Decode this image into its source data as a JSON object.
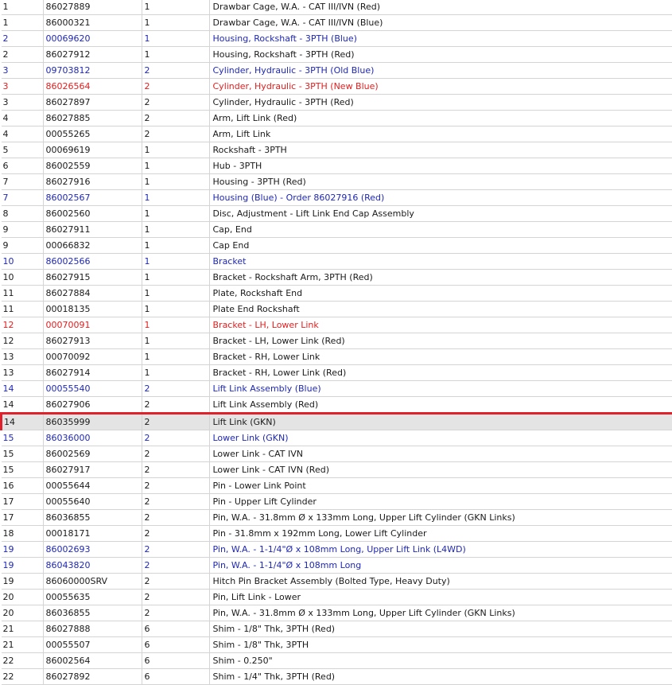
{
  "colors": {
    "default_text": "#1a1a1a",
    "blue_text": "#1f28b3",
    "red_text": "#e02020",
    "selection_outline": "#e0202a",
    "selection_fill": "#e4e4e4",
    "grid_line": "#d4d4d4"
  },
  "rows": [
    {
      "ref": "1",
      "part": "86027889",
      "qty": "1",
      "desc": "Drawbar Cage, W.A. - CAT III/IVN (Red)",
      "style": "dark"
    },
    {
      "ref": "1",
      "part": "86000321",
      "qty": "1",
      "desc": "Drawbar Cage, W.A. - CAT III/IVN (Blue)",
      "style": "dark"
    },
    {
      "ref": "2",
      "part": "00069620",
      "qty": "1",
      "desc": "Housing, Rockshaft - 3PTH (Blue)",
      "style": "blue"
    },
    {
      "ref": "2",
      "part": "86027912",
      "qty": "1",
      "desc": "Housing, Rockshaft - 3PTH (Red)",
      "style": "dark"
    },
    {
      "ref": "3",
      "part": "09703812",
      "qty": "2",
      "desc": "Cylinder, Hydraulic - 3PTH (Old Blue)",
      "style": "blue"
    },
    {
      "ref": "3",
      "part": "86026564",
      "qty": "2",
      "desc": "Cylinder, Hydraulic - 3PTH (New Blue)",
      "style": "red"
    },
    {
      "ref": "3",
      "part": "86027897",
      "qty": "2",
      "desc": "Cylinder, Hydraulic - 3PTH (Red)",
      "style": "dark"
    },
    {
      "ref": "4",
      "part": "86027885",
      "qty": "2",
      "desc": "Arm, Lift Link (Red)",
      "style": "dark"
    },
    {
      "ref": "4",
      "part": "00055265",
      "qty": "2",
      "desc": "Arm, Lift Link",
      "style": "dark"
    },
    {
      "ref": "5",
      "part": "00069619",
      "qty": "1",
      "desc": "Rockshaft - 3PTH",
      "style": "dark"
    },
    {
      "ref": "6",
      "part": "86002559",
      "qty": "1",
      "desc": "Hub - 3PTH",
      "style": "dark"
    },
    {
      "ref": "7",
      "part": "86027916",
      "qty": "1",
      "desc": "Housing - 3PTH (Red)",
      "style": "dark"
    },
    {
      "ref": "7",
      "part": "86002567",
      "qty": "1",
      "desc": "Housing (Blue) - Order 86027916 (Red)",
      "style": "blue"
    },
    {
      "ref": "8",
      "part": "86002560",
      "qty": "1",
      "desc": "Disc, Adjustment - Lift Link End Cap Assembly",
      "style": "dark"
    },
    {
      "ref": "9",
      "part": "86027911",
      "qty": "1",
      "desc": "Cap, End",
      "style": "dark"
    },
    {
      "ref": "9",
      "part": "00066832",
      "qty": "1",
      "desc": "Cap End",
      "style": "dark"
    },
    {
      "ref": "10",
      "part": "86002566",
      "qty": "1",
      "desc": "Bracket",
      "style": "blue"
    },
    {
      "ref": "10",
      "part": "86027915",
      "qty": "1",
      "desc": "Bracket - Rockshaft Arm, 3PTH (Red)",
      "style": "dark"
    },
    {
      "ref": "11",
      "part": "86027884",
      "qty": "1",
      "desc": "Plate, Rockshaft End",
      "style": "dark"
    },
    {
      "ref": "11",
      "part": "00018135",
      "qty": "1",
      "desc": "Plate End Rockshaft",
      "style": "dark"
    },
    {
      "ref": "12",
      "part": "00070091",
      "qty": "1",
      "desc": "Bracket - LH, Lower Link",
      "style": "red"
    },
    {
      "ref": "12",
      "part": "86027913",
      "qty": "1",
      "desc": "Bracket - LH, Lower Link (Red)",
      "style": "dark"
    },
    {
      "ref": "13",
      "part": "00070092",
      "qty": "1",
      "desc": "Bracket - RH, Lower Link",
      "style": "dark"
    },
    {
      "ref": "13",
      "part": "86027914",
      "qty": "1",
      "desc": "Bracket - RH, Lower Link (Red)",
      "style": "dark"
    },
    {
      "ref": "14",
      "part": "00055540",
      "qty": "2",
      "desc": "Lift Link Assembly (Blue)",
      "style": "blue"
    },
    {
      "ref": "14",
      "part": "86027906",
      "qty": "2",
      "desc": "Lift Link Assembly (Red)",
      "style": "dark"
    },
    {
      "ref": "14",
      "part": "86035999",
      "qty": "2",
      "desc": "Lift Link (GKN)",
      "style": "dark",
      "selected": true
    },
    {
      "ref": "15",
      "part": "86036000",
      "qty": "2",
      "desc": "Lower Link (GKN)",
      "style": "blue"
    },
    {
      "ref": "15",
      "part": "86002569",
      "qty": "2",
      "desc": "Lower Link - CAT IVN",
      "style": "dark"
    },
    {
      "ref": "15",
      "part": "86027917",
      "qty": "2",
      "desc": "Lower Link - CAT IVN (Red)",
      "style": "dark"
    },
    {
      "ref": "16",
      "part": "00055644",
      "qty": "2",
      "desc": "Pin - Lower Link Point",
      "style": "dark"
    },
    {
      "ref": "17",
      "part": "00055640",
      "qty": "2",
      "desc": "Pin - Upper Lift Cylinder",
      "style": "dark"
    },
    {
      "ref": "17",
      "part": "86036855",
      "qty": "2",
      "desc": "Pin, W.A. - 31.8mm Ø x 133mm Long, Upper Lift Cylinder (GKN Links)",
      "style": "dark"
    },
    {
      "ref": "18",
      "part": "00018171",
      "qty": "2",
      "desc": "Pin - 31.8mm x 192mm Long, Lower Lift Cylinder",
      "style": "dark"
    },
    {
      "ref": "19",
      "part": "86002693",
      "qty": "2",
      "desc": "Pin, W.A. - 1-1/4\"Ø x 108mm Long, Upper Lift Link (L4WD)",
      "style": "blue"
    },
    {
      "ref": "19",
      "part": "86043820",
      "qty": "2",
      "desc": "Pin, W.A. - 1-1/4\"Ø x 108mm Long",
      "style": "blue"
    },
    {
      "ref": "19",
      "part": "86060000SRV",
      "qty": "2",
      "desc": "Hitch Pin Bracket Assembly (Bolted Type, Heavy Duty)",
      "style": "dark"
    },
    {
      "ref": "20",
      "part": "00055635",
      "qty": "2",
      "desc": "Pin, Lift Link - Lower",
      "style": "dark"
    },
    {
      "ref": "20",
      "part": "86036855",
      "qty": "2",
      "desc": "Pin, W.A. - 31.8mm Ø x 133mm Long, Upper Lift Cylinder (GKN Links)",
      "style": "dark"
    },
    {
      "ref": "21",
      "part": "86027888",
      "qty": "6",
      "desc": "Shim - 1/8\" Thk, 3PTH (Red)",
      "style": "dark"
    },
    {
      "ref": "21",
      "part": "00055507",
      "qty": "6",
      "desc": "Shim - 1/8\" Thk, 3PTH",
      "style": "dark"
    },
    {
      "ref": "22",
      "part": "86002564",
      "qty": "6",
      "desc": "Shim - 0.250\"",
      "style": "dark"
    },
    {
      "ref": "22",
      "part": "86027892",
      "qty": "6",
      "desc": "Shim - 1/4\" Thk, 3PTH (Red)",
      "style": "dark"
    }
  ]
}
